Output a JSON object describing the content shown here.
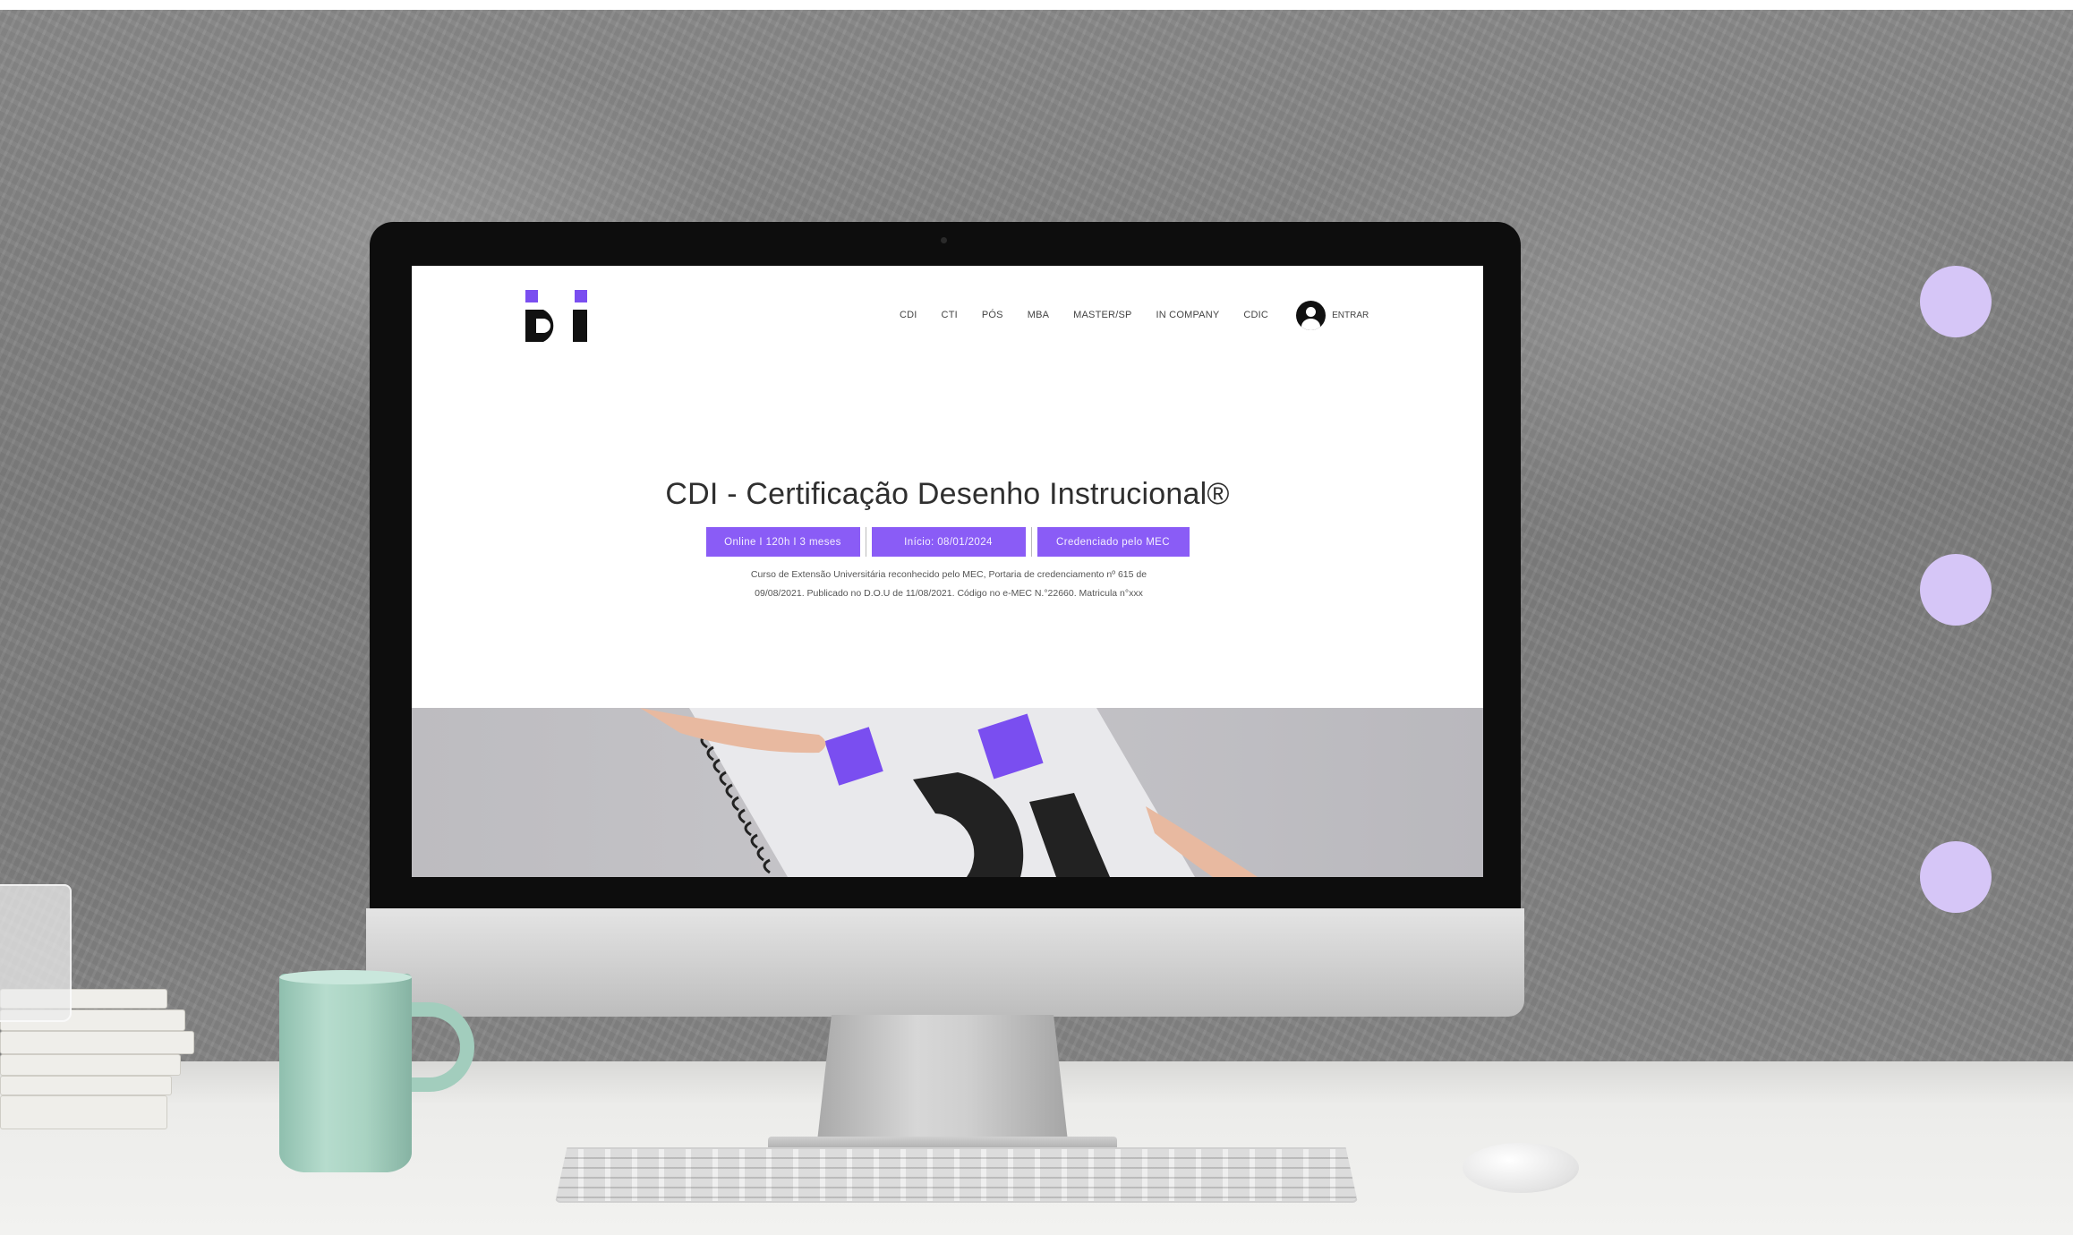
{
  "site": {
    "nav": {
      "items": [
        {
          "label": "CDI"
        },
        {
          "label": "CTI"
        },
        {
          "label": "PÓS"
        },
        {
          "label": "MBA"
        },
        {
          "label": "MASTER/SP"
        },
        {
          "label": "IN COMPANY"
        },
        {
          "label": "CDIC"
        }
      ],
      "login_label": "ENTRAR"
    },
    "hero": {
      "title": "CDI - Certificação Desenho Instrucional®",
      "badges": [
        {
          "text": "Online I 120h I 3 meses"
        },
        {
          "text": "Início: 08/01/2024"
        },
        {
          "text": "Credenciado pelo MEC"
        }
      ],
      "description_line1": "Curso de Extensão Universitária reconhecido pelo MEC, Portaria de credenciamento nº 615 de",
      "description_line2": "09/08/2021. Publicado no D.O.U de 11/08/2021. Código no e-MEC N.°22660. Matricula n°xxx"
    }
  },
  "colors": {
    "brand_purple": "#8a5cf6",
    "logo_purple": "#7a4ef0",
    "side_dots": "#d6c6f7",
    "cup_green": "#a9d3c2"
  },
  "icons": {
    "logo": "di-logo",
    "account": "user-avatar-icon"
  }
}
